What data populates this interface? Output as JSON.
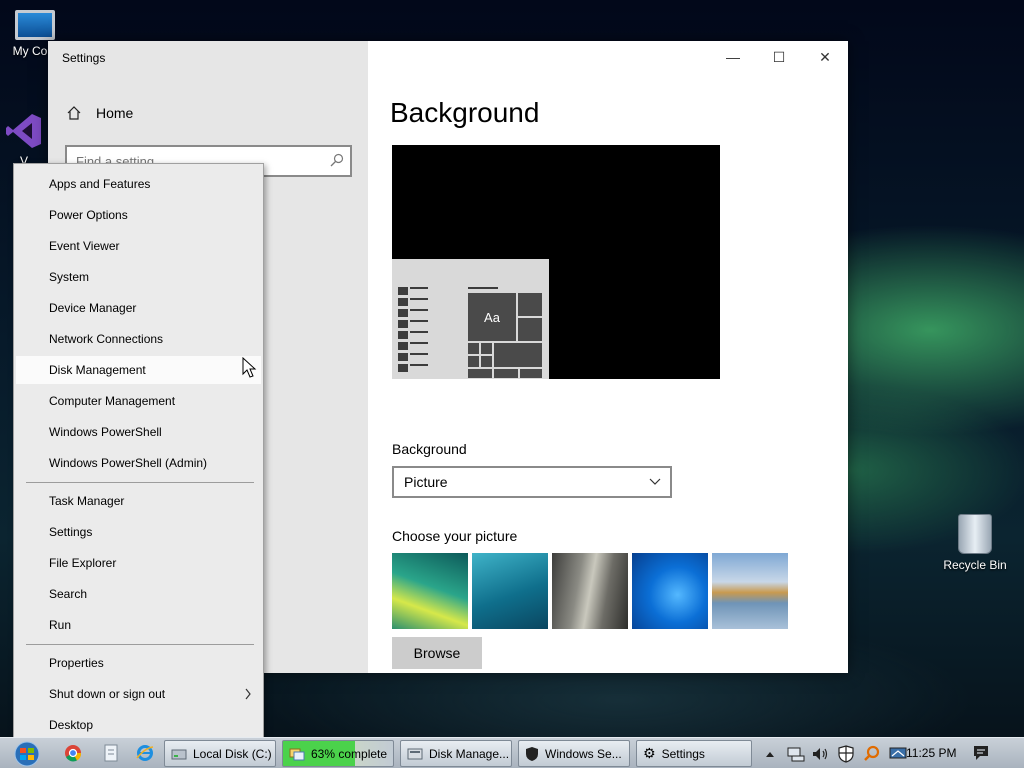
{
  "desktop": {
    "icons": [
      {
        "label": "My Com"
      },
      {
        "label": "V"
      },
      {
        "label": "Recycle Bin"
      }
    ]
  },
  "settings_window": {
    "title": "Settings",
    "controls": {
      "minimize": "—",
      "maximize": "☐",
      "close": "✕"
    },
    "nav": {
      "home_label": "Home",
      "search_placeholder": "Find a setting"
    },
    "main": {
      "page_title": "Background",
      "preview_tile_text": "Aa",
      "background_label": "Background",
      "background_value": "Picture",
      "choose_picture_label": "Choose your picture",
      "browse_label": "Browse"
    }
  },
  "context_menu": {
    "items": [
      {
        "label": "Apps and Features"
      },
      {
        "label": "Power Options"
      },
      {
        "label": "Event Viewer"
      },
      {
        "label": "System"
      },
      {
        "label": "Device Manager"
      },
      {
        "label": "Network Connections"
      },
      {
        "label": "Disk Management",
        "hovered": true
      },
      {
        "label": "Computer Management"
      },
      {
        "label": "Windows PowerShell"
      },
      {
        "label": "Windows PowerShell (Admin)"
      },
      {
        "label": "Task Manager"
      },
      {
        "label": "Settings"
      },
      {
        "label": "File Explorer"
      },
      {
        "label": "Search"
      },
      {
        "label": "Run"
      },
      {
        "label": "Properties"
      },
      {
        "label": "Shut down or sign out",
        "has_submenu": true
      },
      {
        "label": "Desktop"
      }
    ]
  },
  "taskbar": {
    "buttons": [
      {
        "label": "Local Disk (C:)"
      },
      {
        "label": "63% complete",
        "progress_percent": 63
      },
      {
        "label": "Disk Manage..."
      },
      {
        "label": "Windows Se..."
      },
      {
        "label": "Settings"
      }
    ],
    "clock": "11:25 PM"
  },
  "colors": {
    "accent_progress": "#4bd24b",
    "sidebar_bg": "#e6e6e6",
    "menu_bg": "#ebebeb"
  }
}
